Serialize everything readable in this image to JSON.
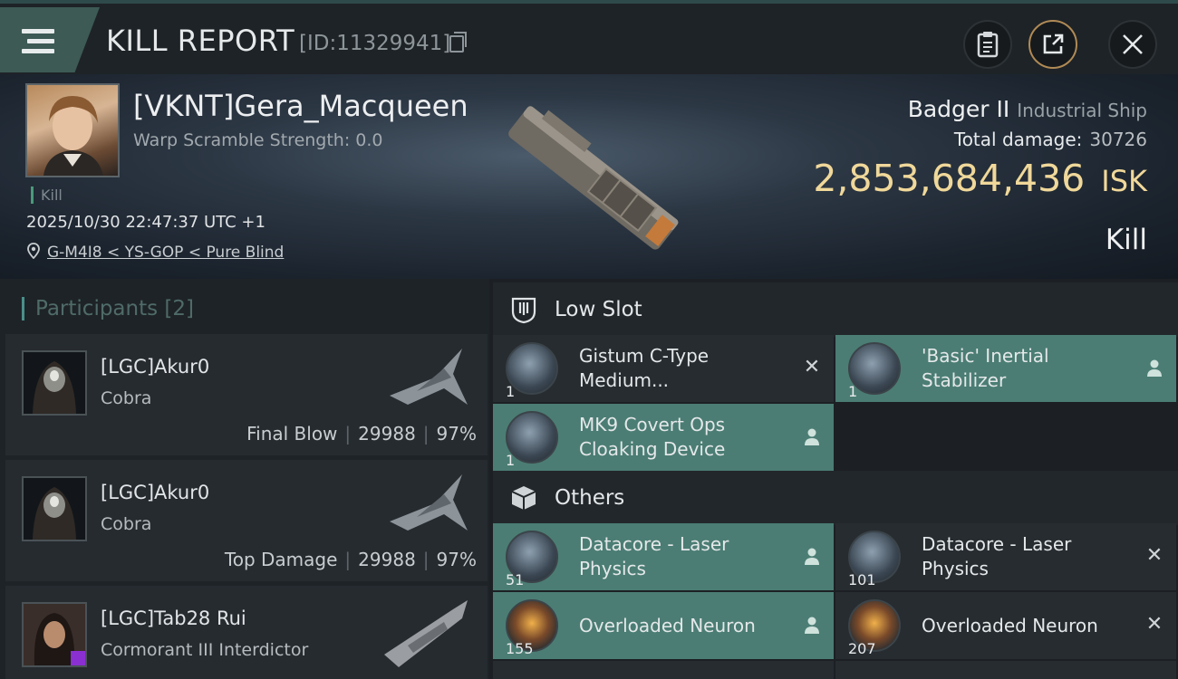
{
  "header": {
    "title": "KILL REPORT",
    "report_id": "[ID:11329941]"
  },
  "victim": {
    "pilot": "[VKNT]Gera_Macqueen",
    "warp_scramble": "Warp Scramble Strength: 0.0",
    "kill_tag": "Kill",
    "timestamp": "2025/10/30 22:47:37 UTC +1",
    "location": "G-M4I8 < YS-GOP < Pure Blind",
    "ship_name": "Badger II",
    "ship_class": "Industrial Ship",
    "total_damage_label": "Total damage:",
    "total_damage": "30726",
    "isk_value": "2,853,684,436",
    "isk_unit": "ISK",
    "result": "Kill"
  },
  "participants": {
    "label": "Participants",
    "count": "[2]",
    "items": [
      {
        "name": "[LGC]Akur0",
        "ship": "Cobra",
        "role": "Final Blow",
        "damage": "29988",
        "percent": "97%"
      },
      {
        "name": "[LGC]Akur0",
        "ship": "Cobra",
        "role": "Top Damage",
        "damage": "29988",
        "percent": "97%"
      },
      {
        "name": "[LGC]Tab28 Rui",
        "ship": "Cormorant III Interdictor"
      }
    ]
  },
  "fitting": {
    "low_slot": {
      "label": "Low Slot",
      "items": [
        {
          "qty": "1",
          "name": "Gistum C-Type Medium...",
          "status": "destroyed"
        },
        {
          "qty": "1",
          "name": "'Basic' Inertial Stabilizer",
          "status": "dropped"
        },
        {
          "qty": "1",
          "name": "MK9 Covert Ops Cloaking Device",
          "status": "dropped"
        }
      ]
    },
    "others": {
      "label": "Others",
      "items": [
        {
          "qty": "51",
          "name": "Datacore - Laser Physics",
          "status": "dropped"
        },
        {
          "qty": "101",
          "name": "Datacore - Laser Physics",
          "status": "destroyed"
        },
        {
          "qty": "155",
          "name": "Overloaded Neuron",
          "status": "dropped"
        },
        {
          "qty": "207",
          "name": "Overloaded Neuron",
          "status": "destroyed"
        }
      ]
    }
  },
  "icons": {
    "menu": "hamburger-icon",
    "copy": "copy-icon",
    "clipboard": "clipboard-icon",
    "share": "share-icon",
    "close": "close-icon",
    "location": "map-pin-icon",
    "low_slot": "low-slot-icon",
    "others": "cube-icon",
    "dropped": "person-icon",
    "destroyed": "x-icon"
  },
  "colors": {
    "accent_teal": "#4b7d74",
    "isk_gold": "#f0d89a",
    "share_ring": "#b08a55"
  }
}
